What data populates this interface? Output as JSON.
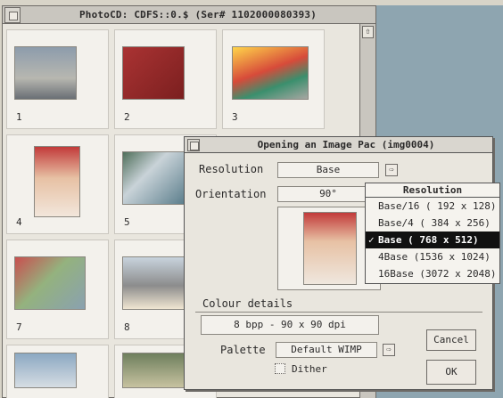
{
  "viewer": {
    "title": "PhotoCD: CDFS::0.$ (Ser# 1102000080393)",
    "thumbnails": [
      {
        "number": "1",
        "desc": ""
      },
      {
        "number": "2",
        "desc": ""
      },
      {
        "number": "3",
        "desc": ""
      },
      {
        "number": "4",
        "desc": ""
      },
      {
        "number": "5",
        "desc": ""
      },
      {
        "number": "7",
        "desc": ""
      },
      {
        "number": "8",
        "desc": ""
      }
    ]
  },
  "dialog": {
    "title": "Opening an Image Pac (img0004)",
    "resolution_label": "Resolution",
    "resolution_value": "Base",
    "orientation_label": "Orientation",
    "orientation_value": "90°",
    "colour_details_label": "Colour details",
    "colour_details_value": "8 bpp - 90 x 90 dpi",
    "palette_label": "Palette",
    "palette_value": "Default WIMP",
    "dither_label": "Dither",
    "cancel_label": "Cancel",
    "ok_label": "OK"
  },
  "menu": {
    "title": "Resolution",
    "items": [
      {
        "label": "Base/16 ( 192 x  128)",
        "selected": false
      },
      {
        "label": "Base/4  ( 384 x  256)",
        "selected": false
      },
      {
        "label": "Base    ( 768 x  512)",
        "selected": true
      },
      {
        "label": "4Base   (1536 x 1024)",
        "selected": false
      },
      {
        "label": "16Base  (3072 x 2048)",
        "selected": false
      }
    ],
    "tick": "✓"
  },
  "icons": {
    "popup_arrow": "⇨",
    "scroll_up": "⇧"
  }
}
